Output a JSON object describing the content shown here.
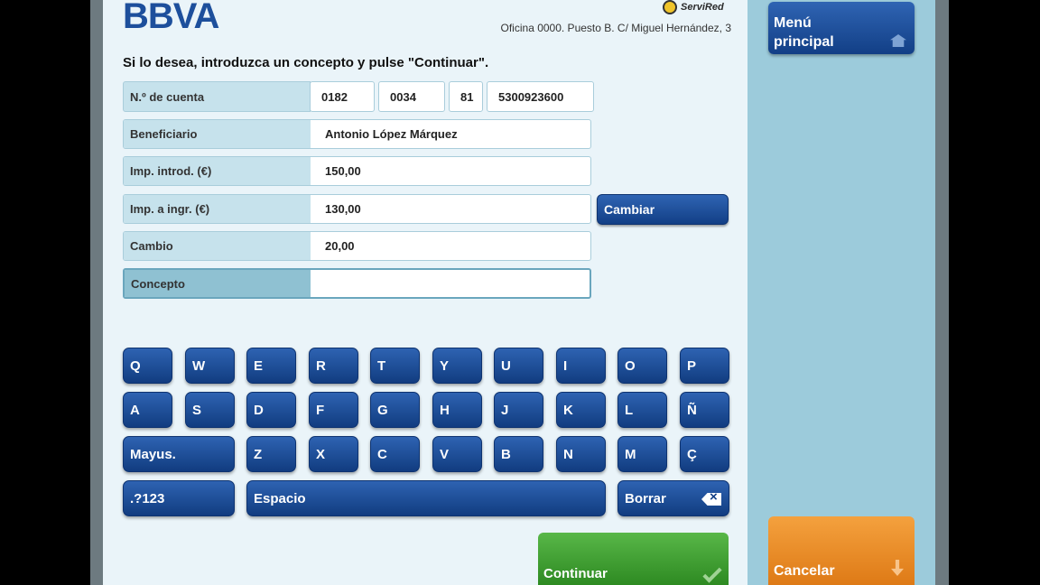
{
  "header": {
    "logo_text": "BBVA",
    "network_logo_text": "ServiRed",
    "office": "Oficina 0000. Puesto B. C/ Miguel Hernández, 3"
  },
  "instruction": "Si lo desea, introduzca un concepto y pulse \"Continuar\".",
  "form": {
    "account": {
      "label": "N.º de cuenta",
      "parts": [
        "0182",
        "0034",
        "81",
        "5300923600"
      ]
    },
    "beneficiary": {
      "label": "Beneficiario",
      "value": "Antonio López Márquez"
    },
    "amount_entered": {
      "label": "Imp. introd. (€)",
      "value": "150,00"
    },
    "amount_to_deposit": {
      "label": "Imp. a ingr. (€)",
      "value": "130,00"
    },
    "change": {
      "label": "Cambio",
      "value": "20,00"
    },
    "concept": {
      "label": "Concepto",
      "value": ""
    },
    "change_button": "Cambiar"
  },
  "keyboard": {
    "row1": [
      "Q",
      "W",
      "E",
      "R",
      "T",
      "Y",
      "U",
      "I",
      "O",
      "P"
    ],
    "row2": [
      "A",
      "S",
      "D",
      "F",
      "G",
      "H",
      "J",
      "K",
      "L",
      "Ñ"
    ],
    "shift": "Mayus.",
    "row3": [
      "Z",
      "X",
      "C",
      "V",
      "B",
      "N",
      "M",
      "Ç"
    ],
    "numbers": ".?123",
    "space": "Espacio",
    "backspace": "Borrar"
  },
  "actions": {
    "continue": "Continuar",
    "cancel": "Cancelar",
    "main_menu_line1": "Menú",
    "main_menu_line2": "principal"
  },
  "colors": {
    "brand_blue": "#1d4f9c",
    "continue_green": "#3f9f33",
    "cancel_orange": "#e98a26",
    "sidebar": "#9ccbdb"
  }
}
